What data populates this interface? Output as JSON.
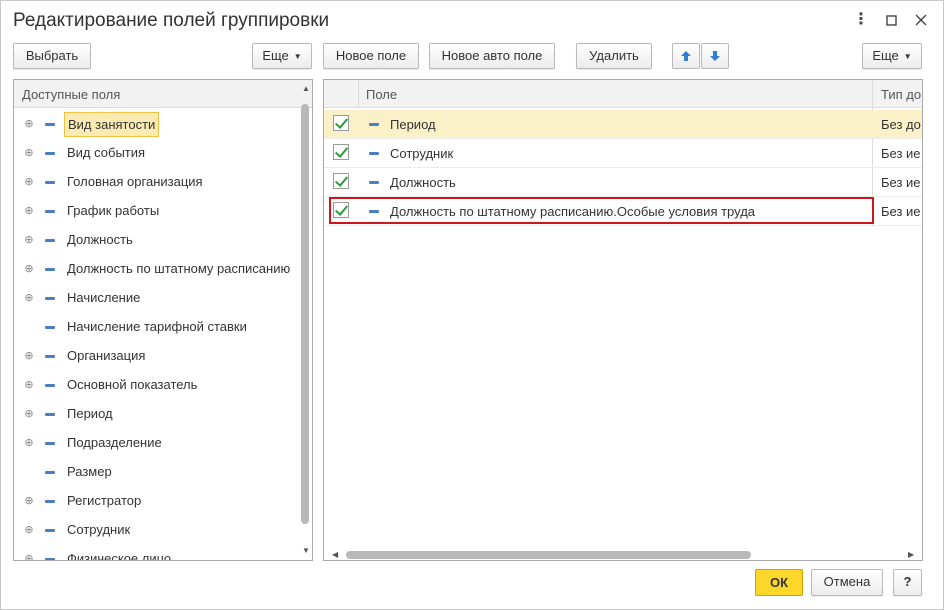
{
  "window": {
    "title": "Редактирование полей группировки",
    "more_icon": "more-vertical-icon",
    "maximize_icon": "maximize-icon",
    "close_icon": "close-icon"
  },
  "left_toolbar": {
    "select_label": "Выбрать",
    "more_label": "Еще"
  },
  "right_toolbar": {
    "new_field_label": "Новое поле",
    "new_auto_field_label": "Новое авто поле",
    "delete_label": "Удалить",
    "more_label": "Еще"
  },
  "available_fields": {
    "header": "Доступные поля",
    "items": [
      {
        "label": "Вид занятости",
        "expandable": true,
        "selected": true
      },
      {
        "label": "Вид события",
        "expandable": true
      },
      {
        "label": "Головная организация",
        "expandable": true
      },
      {
        "label": "График работы",
        "expandable": true
      },
      {
        "label": "Должность",
        "expandable": true
      },
      {
        "label": "Должность по штатному расписанию",
        "expandable": true
      },
      {
        "label": "Начисление",
        "expandable": true
      },
      {
        "label": "Начисление тарифной ставки",
        "expandable": false
      },
      {
        "label": "Организация",
        "expandable": true
      },
      {
        "label": "Основной показатель",
        "expandable": true
      },
      {
        "label": "Период",
        "expandable": true
      },
      {
        "label": "Подразделение",
        "expandable": true
      },
      {
        "label": "Размер",
        "expandable": false
      },
      {
        "label": "Регистратор",
        "expandable": true
      },
      {
        "label": "Сотрудник",
        "expandable": true
      },
      {
        "label": "Физическое лицо",
        "expandable": true
      }
    ]
  },
  "selected_fields": {
    "columns": {
      "field": "Поле",
      "type": "Тип до"
    },
    "rows": [
      {
        "checked": true,
        "field": "Период",
        "type": "Без до"
      },
      {
        "checked": true,
        "field": "Сотрудник",
        "type": "Без ие"
      },
      {
        "checked": true,
        "field": "Должность",
        "type": "Без ие"
      },
      {
        "checked": true,
        "field": "Должность по штатному расписанию.Особые условия труда",
        "type": "Без ие"
      }
    ]
  },
  "footer": {
    "ok_label": "ОК",
    "cancel_label": "Отмена",
    "help_label": "?"
  },
  "colors": {
    "accent_ok": "#fcd72a",
    "selection": "#fbeab1",
    "highlight_border": "#d0141b",
    "field_icon": "#4a7fc1",
    "arrow_icon": "#2f7fd0"
  }
}
